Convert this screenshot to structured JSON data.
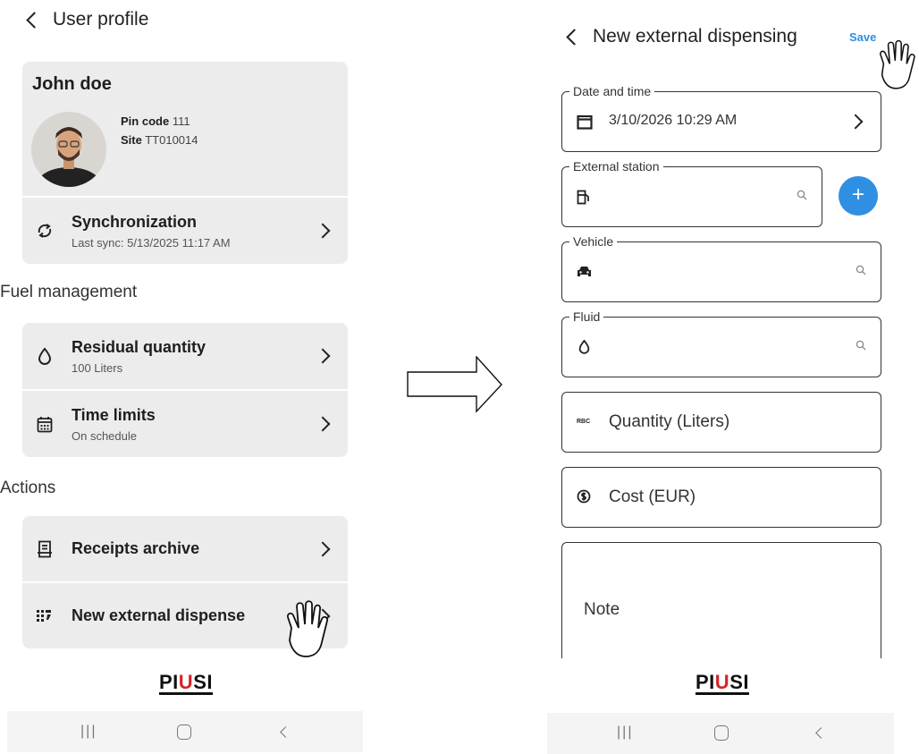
{
  "left": {
    "header": {
      "title": "User profile"
    },
    "user": {
      "name": "John doe",
      "pin_label": "Pin code",
      "pin_value": "111",
      "site_label": "Site",
      "site_value": "TT010014"
    },
    "sync": {
      "title": "Synchronization",
      "subtitle": "Last sync: 5/13/2025 11:17 AM"
    },
    "fuel_section": "Fuel management",
    "residual": {
      "title": "Residual quantity",
      "subtitle": "100 Liters"
    },
    "time_limits": {
      "title": "Time limits",
      "subtitle": "On schedule"
    },
    "actions_section": "Actions",
    "receipts": {
      "title": "Receipts archive"
    },
    "new_dispense": {
      "title": "New external dispense"
    },
    "logo": "PIUSI"
  },
  "right": {
    "header": {
      "title": "New external dispensing",
      "save_label": "Save"
    },
    "date_time": {
      "label": "Date and time",
      "value": "3/10/2026 10:29 AM"
    },
    "external_station": {
      "label": "External station",
      "value": ""
    },
    "vehicle": {
      "label": "Vehicle",
      "value": ""
    },
    "fluid": {
      "label": "Fluid",
      "value": ""
    },
    "quantity": {
      "placeholder": "Quantity (Liters)"
    },
    "cost": {
      "placeholder": "Cost (EUR)"
    },
    "note": {
      "placeholder": "Note"
    },
    "logo": "PIUSI"
  },
  "icons": {
    "abc": "RBC"
  },
  "colors": {
    "accent": "#2f8fe3",
    "card": "#ececec",
    "logo_red": "#d8232a"
  }
}
